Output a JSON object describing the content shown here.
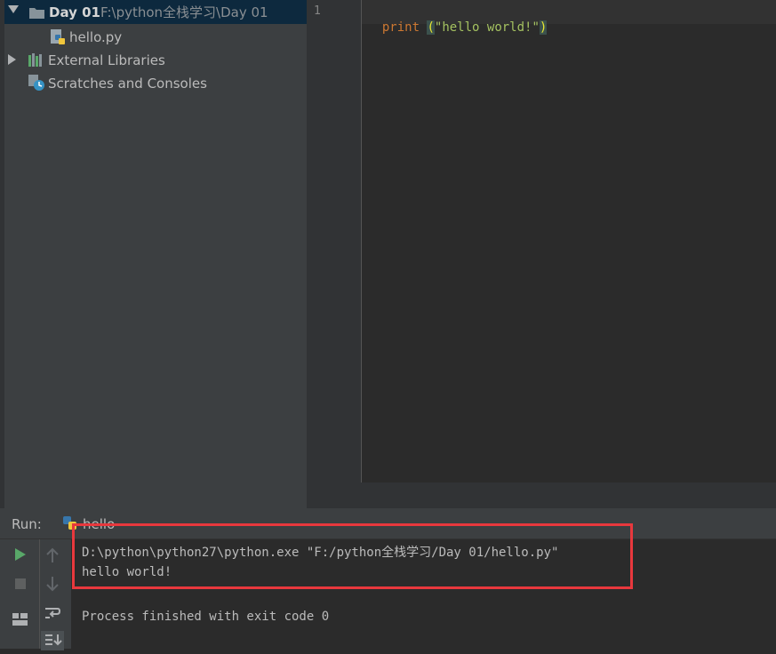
{
  "project_tree": {
    "root": {
      "label": "Day 01",
      "path": "F:\\python全栈学习\\Day 01"
    },
    "file": {
      "label": "hello.py"
    },
    "external_libraries": {
      "label": "External Libraries"
    },
    "scratches": {
      "label": "Scratches and Consoles"
    }
  },
  "editor": {
    "line_number": "1",
    "code": {
      "keyword": "print",
      "open_paren": "(",
      "string": "\"hello world!\"",
      "close_paren": ")"
    }
  },
  "run_panel": {
    "label": "Run:",
    "tab_label": "hello",
    "console_lines": [
      "D:\\python\\python27\\python.exe \"F:/python全栈学习/Day 01/hello.py\"",
      "hello world!",
      "Process finished with exit code 0"
    ]
  },
  "colors": {
    "keyword": "#cc7832",
    "string": "#6a8759",
    "highlight": "#e8383d",
    "run_green": "#59a869"
  },
  "icons": [
    "expand-arrow-icon",
    "folder-icon",
    "python-file-icon",
    "libraries-icon",
    "scratches-icon",
    "run-icon",
    "stop-icon",
    "up-arrow-icon",
    "down-arrow-icon",
    "soft-wrap-icon",
    "scroll-to-end-icon",
    "layout-icon"
  ]
}
